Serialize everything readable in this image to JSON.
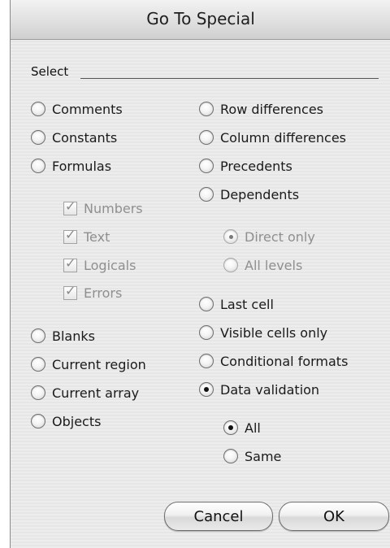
{
  "dialog": {
    "title": "Go To Special",
    "section_label": "Select"
  },
  "left_options": {
    "comments": "Comments",
    "constants": "Constants",
    "formulas": "Formulas",
    "numbers": "Numbers",
    "text": "Text",
    "logicals": "Logicals",
    "errors": "Errors",
    "blanks": "Blanks",
    "current_region": "Current region",
    "current_array": "Current array",
    "objects": "Objects"
  },
  "right_options": {
    "row_differences": "Row differences",
    "column_differences": "Column differences",
    "precedents": "Precedents",
    "dependents": "Dependents",
    "direct_only": "Direct only",
    "all_levels": "All levels",
    "last_cell": "Last cell",
    "visible_cells_only": "Visible cells only",
    "conditional_formats": "Conditional formats",
    "data_validation": "Data validation",
    "all": "All",
    "same": "Same"
  },
  "state": {
    "selected_option": "Data validation",
    "selected_validation_scope": "All",
    "selected_dependents_scope": "Direct only",
    "formula_types_checked": [
      "Numbers",
      "Text",
      "Logicals",
      "Errors"
    ]
  },
  "buttons": {
    "cancel": "Cancel",
    "ok": "OK"
  }
}
